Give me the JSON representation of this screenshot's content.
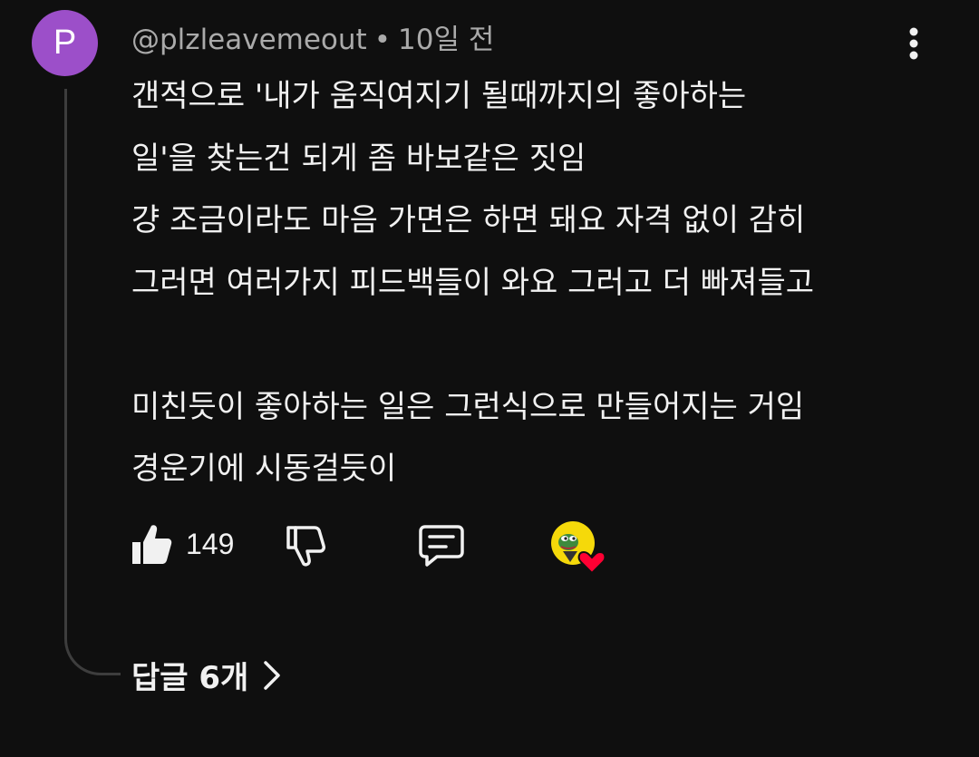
{
  "comment": {
    "avatar_letter": "P",
    "author": "@plzleavemeout",
    "separator": "•",
    "time": "10일 전",
    "lines": [
      "갠적으로 '내가 움직여지기 될때까지의 좋아하는",
      "일'을 찾는건 되게 좀 바보같은 짓임",
      "걍 조금이라도 마음 가면은 하면 돼요 자격 없이 감히",
      "그러면 여러가지 피드백들이 와요 그러고 더 빠져들고",
      "",
      "미친듯이 좋아하는 일은 그런식으로 만들어지는 거임",
      "경운기에 시동걸듯이"
    ],
    "like_count": "149",
    "replies_label": "답글 6개"
  },
  "icons": {
    "more": "more-vert-icon",
    "like": "thumb-up-icon",
    "dislike": "thumb-down-icon",
    "reply": "comment-icon",
    "creator_heart": "creator-heart-icon"
  },
  "colors": {
    "background": "#0f0f0f",
    "avatar": "#9c4fc9",
    "heart": "#ff0033",
    "creator_badge": "#f5d90a",
    "meta_text": "#aaaaaa"
  }
}
